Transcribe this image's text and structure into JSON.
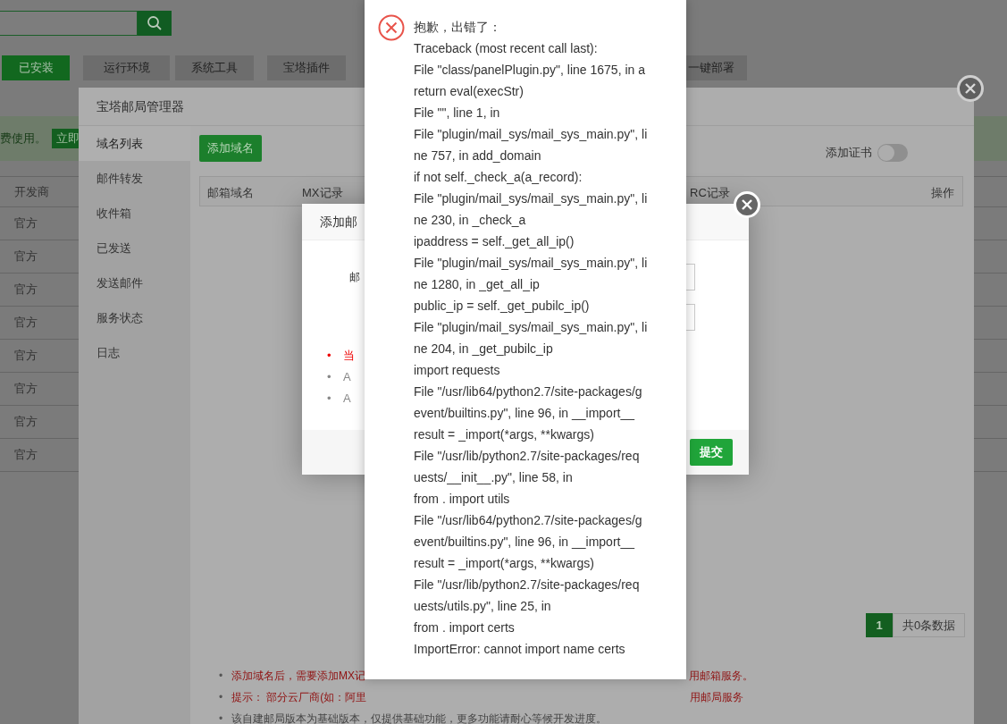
{
  "page": {
    "tabs": [
      {
        "label": "已安装",
        "selected": true
      },
      {
        "label": "运行环境",
        "selected": false
      },
      {
        "label": "系统工具",
        "selected": false
      },
      {
        "label": "宝塔插件",
        "selected": false
      },
      {
        "label": "一键部署",
        "selected": false
      }
    ],
    "banner": {
      "text": "费使用。",
      "button": "立即"
    },
    "table": {
      "columns": [
        "开发商"
      ],
      "rows": [
        "官方",
        "官方",
        "官方",
        "官方",
        "官方",
        "官方",
        "官方",
        "官方"
      ]
    }
  },
  "mail_manager": {
    "title": "宝塔邮局管理器",
    "sidebar": [
      {
        "label": "域名列表",
        "selected": true
      },
      {
        "label": "邮件转发",
        "selected": false
      },
      {
        "label": "收件箱",
        "selected": false
      },
      {
        "label": "已发送",
        "selected": false
      },
      {
        "label": "发送邮件",
        "selected": false
      },
      {
        "label": "服务状态",
        "selected": false
      },
      {
        "label": "日志",
        "selected": false
      }
    ],
    "add_button": "添加域名",
    "cert_toggle": {
      "label": "添加证书",
      "on": false
    },
    "columns": [
      "邮箱域名",
      "MX记录",
      "RC记录",
      "操作"
    ],
    "pagination": {
      "page": "1",
      "total": "共0条数据"
    },
    "notes": [
      {
        "kind": "warning",
        "bullet": "•",
        "left": "添加域名后，需要添加MX记",
        "right": "用邮箱服务。"
      },
      {
        "kind": "warning",
        "bullet": "•",
        "left": "提示： 部分云厂商(如：阿里",
        "right": "用邮局服务"
      },
      {
        "kind": "info",
        "bullet": "•",
        "left": "该自建邮局版本为基础版本，仅提供基础功能，更多功能请耐心等候开发进度。"
      }
    ]
  },
  "add_dialog": {
    "title": "添加邮",
    "field_label": "邮",
    "tips": [
      {
        "kind": "warning",
        "bullet": "•",
        "text": "当"
      },
      {
        "kind": "info",
        "bullet": "•",
        "text": "A"
      },
      {
        "kind": "info",
        "bullet": "•",
        "text": "A"
      }
    ],
    "submit": "提交"
  },
  "error_popup": {
    "lines": [
      "抱歉，出错了：",
      "Traceback (most recent call last):",
      "File \"class/panelPlugin.py\", line 1675, in a",
      "return eval(execStr)",
      "File \"\", line 1, in",
      "File \"plugin/mail_sys/mail_sys_main.py\", li",
      "ne 757, in add_domain",
      "if not self._check_a(a_record):",
      "File \"plugin/mail_sys/mail_sys_main.py\", li",
      "ne 230, in _check_a",
      "ipaddress = self._get_all_ip()",
      "File \"plugin/mail_sys/mail_sys_main.py\", li",
      "ne 1280, in _get_all_ip",
      "public_ip = self._get_pubilc_ip()",
      "File \"plugin/mail_sys/mail_sys_main.py\", li",
      "ne 204, in _get_pubilc_ip",
      "import requests",
      "File \"/usr/lib64/python2.7/site-packages/g",
      "event/builtins.py\", line 96, in __import__",
      "result = _import(*args, **kwargs)",
      "File \"/usr/lib/python2.7/site-packages/req",
      "uests/__init__.py\", line 58, in",
      "from . import utils",
      "File \"/usr/lib64/python2.7/site-packages/g",
      "event/builtins.py\", line 96, in __import__",
      "result = _import(*args, **kwargs)",
      "File \"/usr/lib/python2.7/site-packages/req",
      "uests/utils.py\", line 25, in",
      "from . import certs",
      "ImportError: cannot import name certs"
    ]
  }
}
